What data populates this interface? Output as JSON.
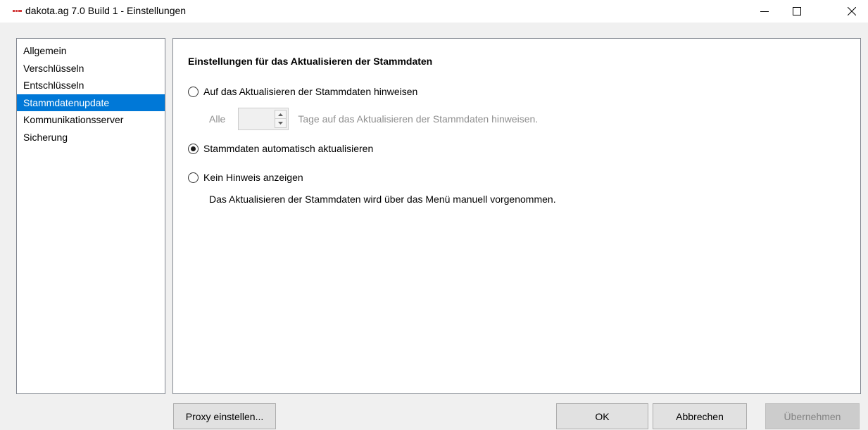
{
  "window": {
    "title": "dakota.ag 7.0 Build 1 - Einstellungen",
    "icons": {
      "app": "dakota-logo-icon",
      "minimize": "minimize-icon",
      "maximize": "maximize-icon",
      "close": "close-icon"
    }
  },
  "nav": {
    "items": [
      {
        "label": "Allgemein",
        "selected": false
      },
      {
        "label": "Verschlüsseln",
        "selected": false
      },
      {
        "label": "Entschlüsseln",
        "selected": false
      },
      {
        "label": "Stammdatenupdate",
        "selected": true
      },
      {
        "label": "Kommunikationsserver",
        "selected": false
      },
      {
        "label": "Sicherung",
        "selected": false
      }
    ]
  },
  "content": {
    "section_title": "Einstellungen für das Aktualisieren der Stammdaten",
    "options": [
      {
        "label": "Auf das Aktualisieren der Stammdaten hinweisen",
        "checked": false
      },
      {
        "label": "Stammdaten automatisch aktualisieren",
        "checked": true
      },
      {
        "label": "Kein Hinweis anzeigen",
        "checked": false
      }
    ],
    "days": {
      "prefix": "Alle",
      "value": "",
      "suffix": "Tage auf das Aktualisieren der Stammdaten hinweisen.",
      "enabled": false
    },
    "no_hint_description": "Das Aktualisieren der Stammdaten wird über das Menü manuell vorgenommen."
  },
  "buttons": {
    "proxy": "Proxy einstellen...",
    "ok": "OK",
    "cancel": "Abbrechen",
    "apply": "Übernehmen"
  },
  "colors": {
    "selection": "#0078d7",
    "disabled_text": "#8f8f8f",
    "button_face": "#e1e1e1"
  }
}
